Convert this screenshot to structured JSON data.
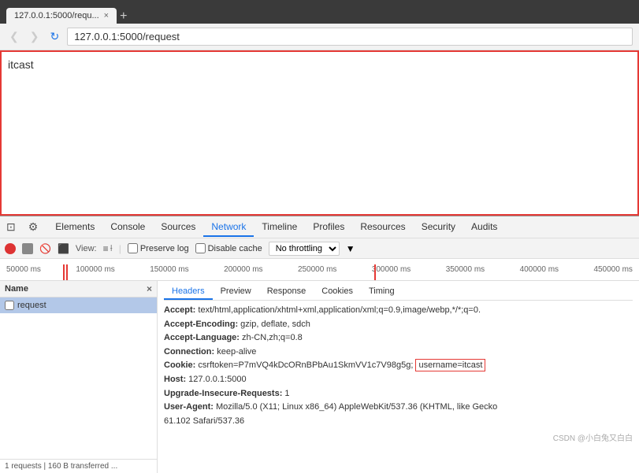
{
  "browser": {
    "tab_title": "127.0.0.1:5000/requ...",
    "tab_close": "×",
    "tab_new": "+",
    "nav_back": "❮",
    "nav_forward": "❯",
    "reload": "↻",
    "url": "127.0.0.1:5000/request",
    "page_text": "itcast"
  },
  "devtools": {
    "tabs": [
      {
        "label": "Elements"
      },
      {
        "label": "Console"
      },
      {
        "label": "Sources"
      },
      {
        "label": "Network",
        "active": true
      },
      {
        "label": "Timeline"
      },
      {
        "label": "Profiles"
      },
      {
        "label": "Resources"
      },
      {
        "label": "Security"
      },
      {
        "label": "Audits"
      }
    ],
    "network": {
      "preserve_log": "Preserve log",
      "disable_cache": "Disable cache",
      "no_throttling": "No throttling",
      "view_label": "View:",
      "ruler_ticks": [
        "50000 ms",
        "100000 ms",
        "150000 ms",
        "200000 ms",
        "250000 ms",
        "300000 ms",
        "350000 ms",
        "400000 ms",
        "450000 ms"
      ],
      "name_column": "Name",
      "request_name": "request",
      "status_bar": "1 requests  |  160 B transferred ...",
      "headers_tabs": [
        "Headers",
        "Preview",
        "Response",
        "Cookies",
        "Timing"
      ],
      "headers_content": [
        {
          "bold": "Accept:",
          "rest": " text/html,application/xhtml+xml,application/xml;q=0.9,image/webp,*/*;q=0."
        },
        {
          "bold": "Accept-Encoding:",
          "rest": " gzip, deflate, sdch"
        },
        {
          "bold": "Accept-Language:",
          "rest": " zh-CN,zh;q=0.8"
        },
        {
          "bold": "Connection:",
          "rest": " keep-alive"
        },
        {
          "bold": "Cookie:",
          "rest": " csrftoken=P7mVQ4kDcORnBPbAu1SkmVV1c7V98g5g;",
          "highlight": "username=itcast"
        },
        {
          "bold": "Host:",
          "rest": " 127.0.0.1:5000"
        },
        {
          "bold": "Upgrade-Insecure-Requests:",
          "rest": " 1"
        },
        {
          "bold": "User-Agent:",
          "rest": " Mozilla/5.0 (X11; Linux x86_64) AppleWebKit/537.36 (KHTML, like Gecko"
        },
        {
          "bold": "",
          "rest": " 61.102 Safari/537.36"
        }
      ],
      "watermark": "CSDN @小白兔又白白"
    }
  }
}
